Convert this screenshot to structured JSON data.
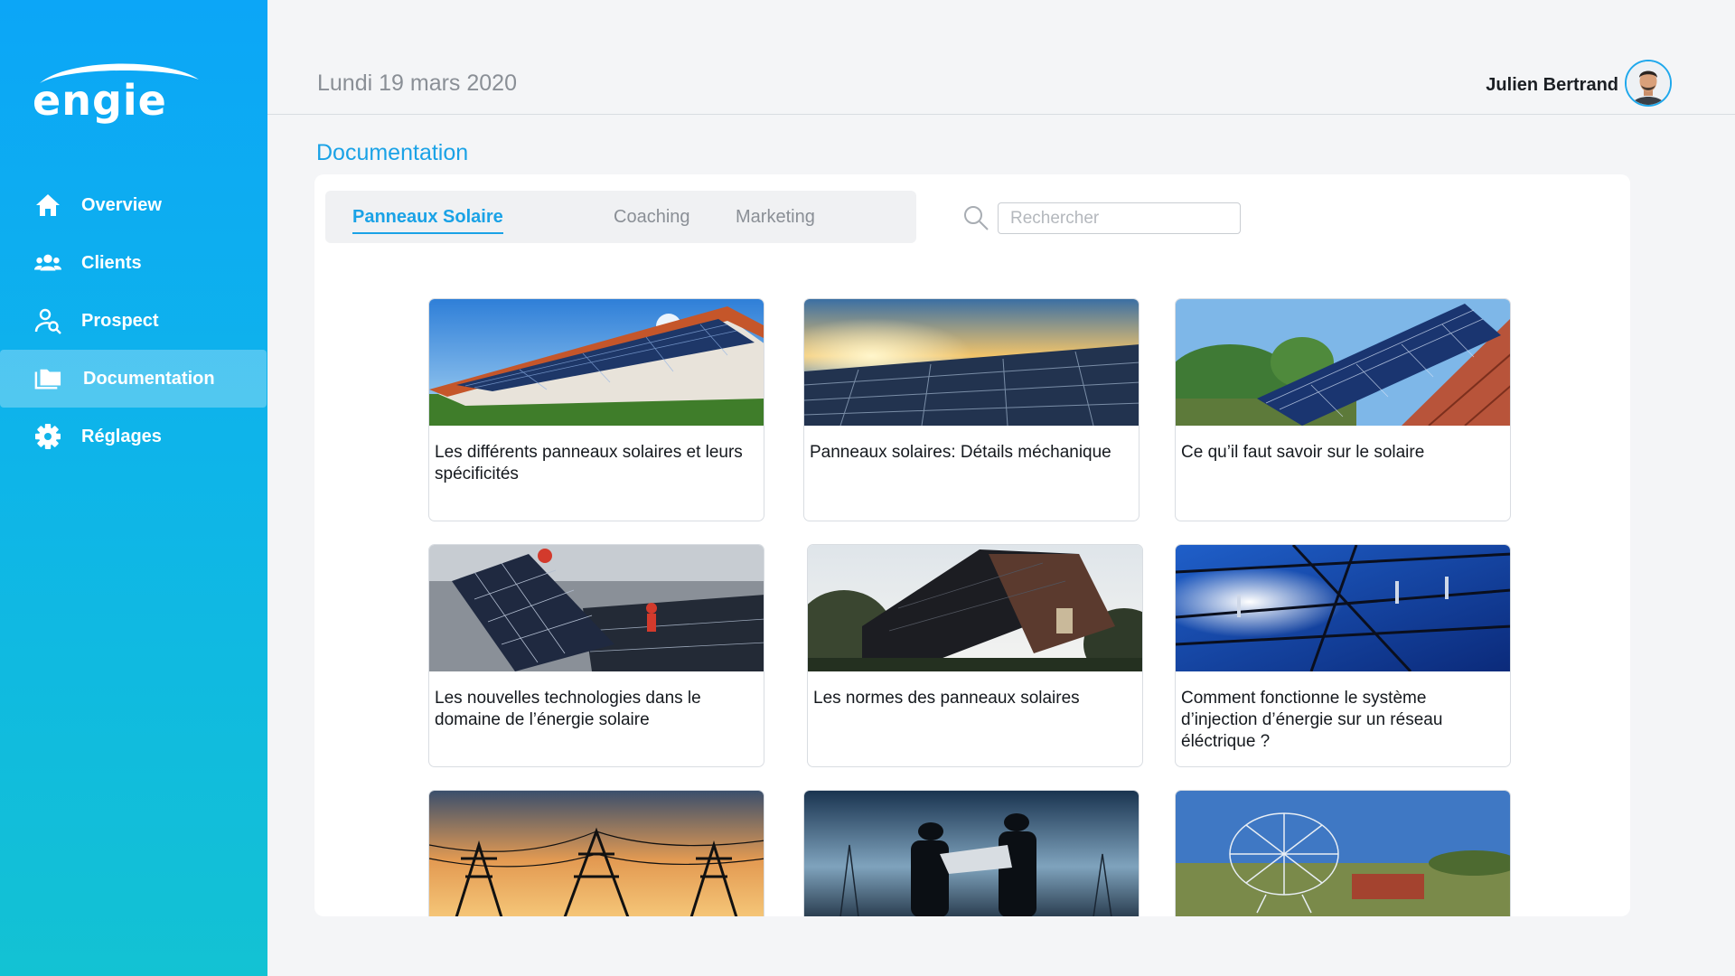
{
  "brand": {
    "logo_text": "engie",
    "primary_color": "#1aa2e6"
  },
  "sidebar": {
    "items": [
      {
        "label": "Overview",
        "icon": "home-icon",
        "active": false
      },
      {
        "label": "Clients",
        "icon": "users-icon",
        "active": false
      },
      {
        "label": "Prospect",
        "icon": "user-search-icon",
        "active": false
      },
      {
        "label": "Documentation",
        "icon": "folder-icon",
        "active": true
      },
      {
        "label": "Réglages",
        "icon": "gear-icon",
        "active": false
      }
    ]
  },
  "header": {
    "date": "Lundi 19 mars 2020",
    "user_name": "Julien Bertrand"
  },
  "page": {
    "title": "Documentation"
  },
  "tabs": [
    {
      "label": "Panneaux Solaire",
      "active": true
    },
    {
      "label": "Coaching",
      "active": false
    },
    {
      "label": "Marketing",
      "active": false
    }
  ],
  "search": {
    "placeholder": "Rechercher",
    "value": ""
  },
  "cards": [
    {
      "title": "Les différents panneaux solaires et leurs spécificités",
      "image": "solar-roof-house"
    },
    {
      "title": "Panneaux solaires: Détails méchanique",
      "image": "solar-panels-sunset"
    },
    {
      "title": "Ce qu’il faut savoir sur le solaire",
      "image": "solar-panel-tiles"
    },
    {
      "title": "Les nouvelles technologies dans le domaine de l’énergie solaire",
      "image": "workers-installing-panels"
    },
    {
      "title": "Les normes des panneaux solaires",
      "image": "house-solar-roof-dusk"
    },
    {
      "title": "Comment fonctionne le système d’injection d’énergie sur un réseau éléctrique ?",
      "image": "power-pylon-blue-sky"
    },
    {
      "title": "",
      "image": "power-lines-sunset"
    },
    {
      "title": "",
      "image": "engineers-silhouette"
    },
    {
      "title": "",
      "image": "solar-concentrator-field"
    }
  ]
}
